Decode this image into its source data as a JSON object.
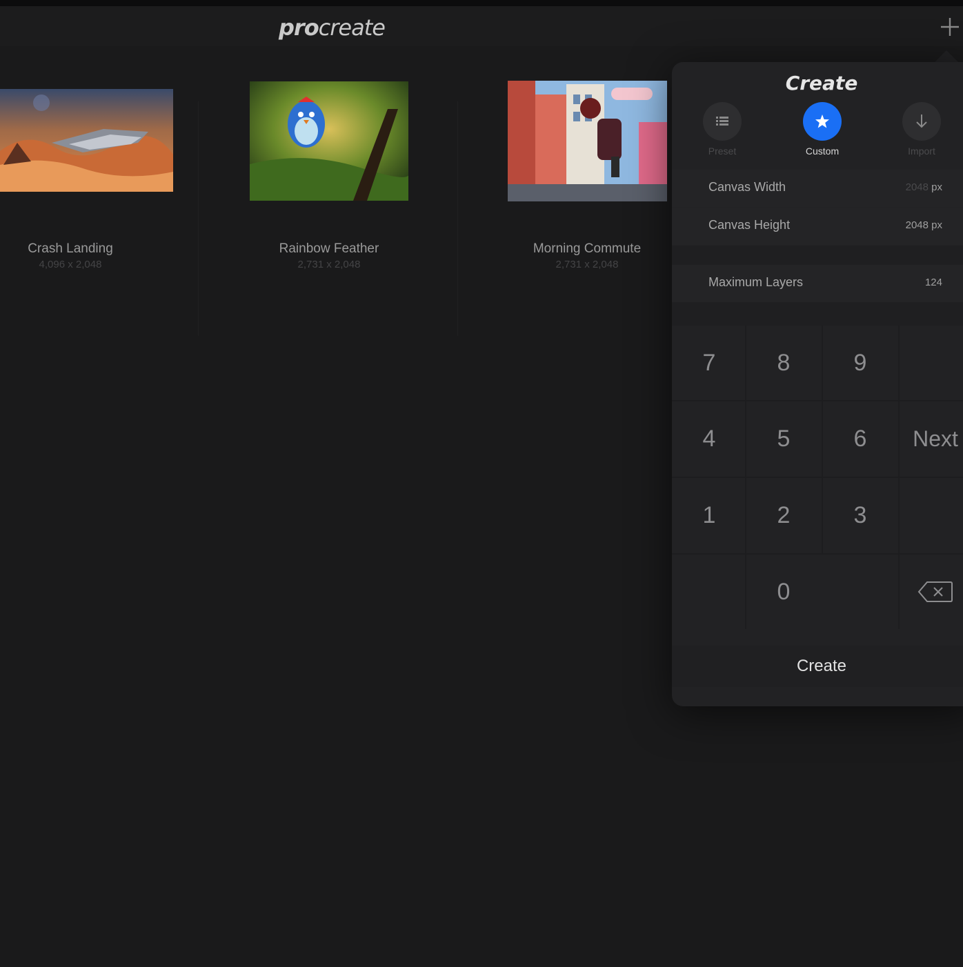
{
  "app": {
    "logo_bold": "pro",
    "logo_light": "create"
  },
  "toolbar": {
    "add_icon": "plus-icon"
  },
  "gallery": {
    "items": [
      {
        "title": "Crash Landing",
        "size": "4,096 x 2,048"
      },
      {
        "title": "Rainbow Feather",
        "size": "2,731 x 2,048"
      },
      {
        "title": "Morning Commute",
        "size": "2,731 x 2,048"
      }
    ]
  },
  "create_panel": {
    "title": "Create",
    "modes": [
      {
        "label": "Preset",
        "icon": "list-icon",
        "active": false
      },
      {
        "label": "Custom",
        "icon": "star-icon",
        "active": true
      },
      {
        "label": "Import",
        "icon": "download-arrow-icon",
        "active": false
      }
    ],
    "fields": {
      "width_label": "Canvas Width",
      "width_value": "2048",
      "width_unit": "px",
      "height_label": "Canvas Height",
      "height_value": "2048",
      "height_unit": "px",
      "layers_label": "Maximum Layers",
      "layers_value": "124"
    },
    "keypad": {
      "k7": "7",
      "k8": "8",
      "k9": "9",
      "k4": "4",
      "k5": "5",
      "k6": "6",
      "k1": "1",
      "k2": "2",
      "k3": "3",
      "k0": "0",
      "next": "Next",
      "backspace_icon": "backspace-icon"
    },
    "create_label": "Create"
  },
  "colors": {
    "accent": "#1a6ff5",
    "background": "#1a1a1b",
    "panel": "#222224"
  }
}
